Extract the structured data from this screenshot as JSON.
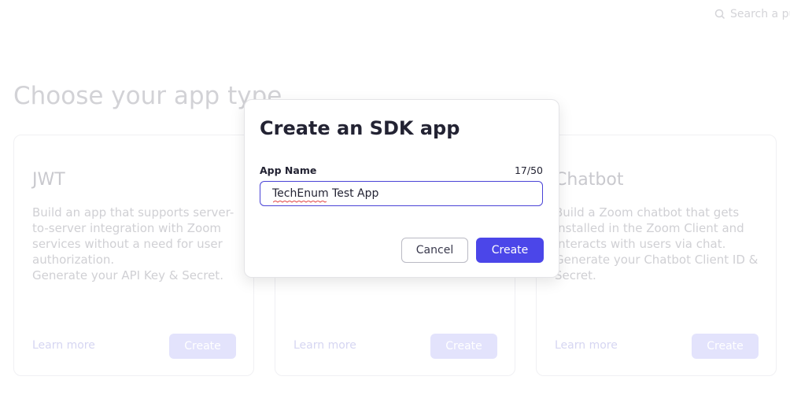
{
  "search": {
    "placeholder": "Search a pu",
    "icon": "search-icon"
  },
  "page": {
    "heading": "Choose your app type"
  },
  "cards": [
    {
      "title": "JWT",
      "description": "Build an app that supports server-to-server integration with Zoom services without a need for user authorization.\nGenerate your API Key & Secret.",
      "learn_more": "Learn more",
      "create": "Create"
    },
    {
      "title": "",
      "description": "",
      "learn_more": "Learn more",
      "create": "Create"
    },
    {
      "title": "Chatbot",
      "description": "Build a Zoom chatbot that gets installed in the Zoom Client and interacts with users via chat.\nGenerate your Chatbot Client ID & Secret.",
      "learn_more": "Learn more",
      "create": "Create"
    }
  ],
  "modal": {
    "title": "Create an SDK app",
    "field_label": "App Name",
    "char_count": "17/50",
    "app_name_value": "TechEnum Test App",
    "cancel_label": "Cancel",
    "create_label": "Create"
  },
  "colors": {
    "accent": "#4b46e9",
    "input_border": "#4a43d6",
    "text_dark": "#232333"
  }
}
